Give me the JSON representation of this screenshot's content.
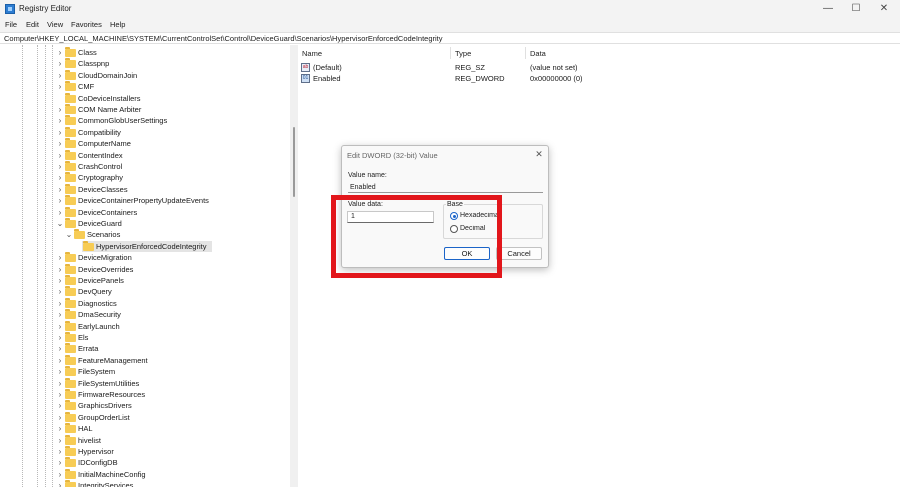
{
  "window": {
    "title": "Registry Editor",
    "controls": [
      "—",
      "☐",
      "✕"
    ]
  },
  "menu": [
    "File",
    "Edit",
    "View",
    "Favorites",
    "Help"
  ],
  "address": "Computer\\HKEY_LOCAL_MACHINE\\SYSTEM\\CurrentControlSet\\Control\\DeviceGuard\\Scenarios\\HypervisorEnforcedCodeIntegrity",
  "tree": {
    "items": [
      {
        "label": "Class",
        "expandable": true
      },
      {
        "label": "Classpnp",
        "expandable": true
      },
      {
        "label": "CloudDomainJoin",
        "expandable": true
      },
      {
        "label": "CMF",
        "expandable": true
      },
      {
        "label": "CoDeviceInstallers",
        "expandable": false
      },
      {
        "label": "COM Name Arbiter",
        "expandable": true
      },
      {
        "label": "CommonGlobUserSettings",
        "expandable": true
      },
      {
        "label": "Compatibility",
        "expandable": true
      },
      {
        "label": "ComputerName",
        "expandable": true
      },
      {
        "label": "ContentIndex",
        "expandable": true
      },
      {
        "label": "CrashControl",
        "expandable": true
      },
      {
        "label": "Cryptography",
        "expandable": true
      },
      {
        "label": "DeviceClasses",
        "expandable": true
      },
      {
        "label": "DeviceContainerPropertyUpdateEvents",
        "expandable": true
      },
      {
        "label": "DeviceContainers",
        "expandable": true
      },
      {
        "label": "DeviceGuard",
        "expandable": true,
        "expanded": true
      },
      {
        "label": "Scenarios",
        "expandable": true,
        "expanded": true
      },
      {
        "label": "HypervisorEnforcedCodeIntegrity",
        "expandable": false,
        "selected": true
      },
      {
        "label": "DeviceMigration",
        "expandable": true
      },
      {
        "label": "DeviceOverrides",
        "expandable": true
      },
      {
        "label": "DevicePanels",
        "expandable": true
      },
      {
        "label": "DevQuery",
        "expandable": true
      },
      {
        "label": "Diagnostics",
        "expandable": true
      },
      {
        "label": "DmaSecurity",
        "expandable": true
      },
      {
        "label": "EarlyLaunch",
        "expandable": true
      },
      {
        "label": "Els",
        "expandable": true
      },
      {
        "label": "Errata",
        "expandable": true
      },
      {
        "label": "FeatureManagement",
        "expandable": true
      },
      {
        "label": "FileSystem",
        "expandable": true
      },
      {
        "label": "FileSystemUtilities",
        "expandable": true
      },
      {
        "label": "FirmwareResources",
        "expandable": true
      },
      {
        "label": "GraphicsDrivers",
        "expandable": true
      },
      {
        "label": "GroupOrderList",
        "expandable": true
      },
      {
        "label": "HAL",
        "expandable": true
      },
      {
        "label": "hivelist",
        "expandable": true
      },
      {
        "label": "Hypervisor",
        "expandable": true
      },
      {
        "label": "IDConfigDB",
        "expandable": true
      },
      {
        "label": "InitialMachineConfig",
        "expandable": true
      },
      {
        "label": "IntegrityServices",
        "expandable": true
      }
    ]
  },
  "values_pane": {
    "columns": {
      "name": "Name",
      "type": "Type",
      "data": "Data"
    },
    "rows": [
      {
        "name": "(Default)",
        "type": "REG_SZ",
        "data": "(value not set)",
        "icon": "string-value-icon"
      },
      {
        "name": "Enabled",
        "type": "REG_DWORD",
        "data": "0x00000000 (0)",
        "icon": "dword-value-icon"
      }
    ]
  },
  "dialog": {
    "title": "Edit DWORD (32-bit) Value",
    "value_name_label": "Value name:",
    "value_name": "Enabled",
    "value_data_label": "Value data:",
    "value_data": "1",
    "base_label": "Base",
    "hex_label": "Hexadecimal",
    "dec_label": "Decimal",
    "base_selected": "hex",
    "ok_label": "OK",
    "cancel_label": "Cancel"
  },
  "accent_colors": {
    "highlight": "#e2161b",
    "folder": "#f7cc55",
    "radio": "#1b64c8"
  }
}
